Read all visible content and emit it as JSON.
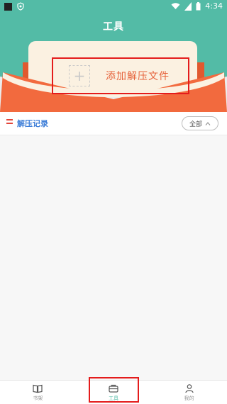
{
  "statusbar": {
    "time": "4:34"
  },
  "header": {
    "title": "工具"
  },
  "add": {
    "label": "添加解压文件",
    "plus": "+"
  },
  "records": {
    "title": "解压记录",
    "filter_label": "全部"
  },
  "tabs": [
    {
      "label": "书架",
      "icon": "book-icon",
      "active": false
    },
    {
      "label": "工具",
      "icon": "toolbox-icon",
      "active": true
    },
    {
      "label": "我的",
      "icon": "user-icon",
      "active": false
    }
  ],
  "colors": {
    "accent": "#53bba6",
    "envelope": "#f26a3e",
    "highlight": "#e41c1c",
    "record_title": "#3f7fd8"
  }
}
